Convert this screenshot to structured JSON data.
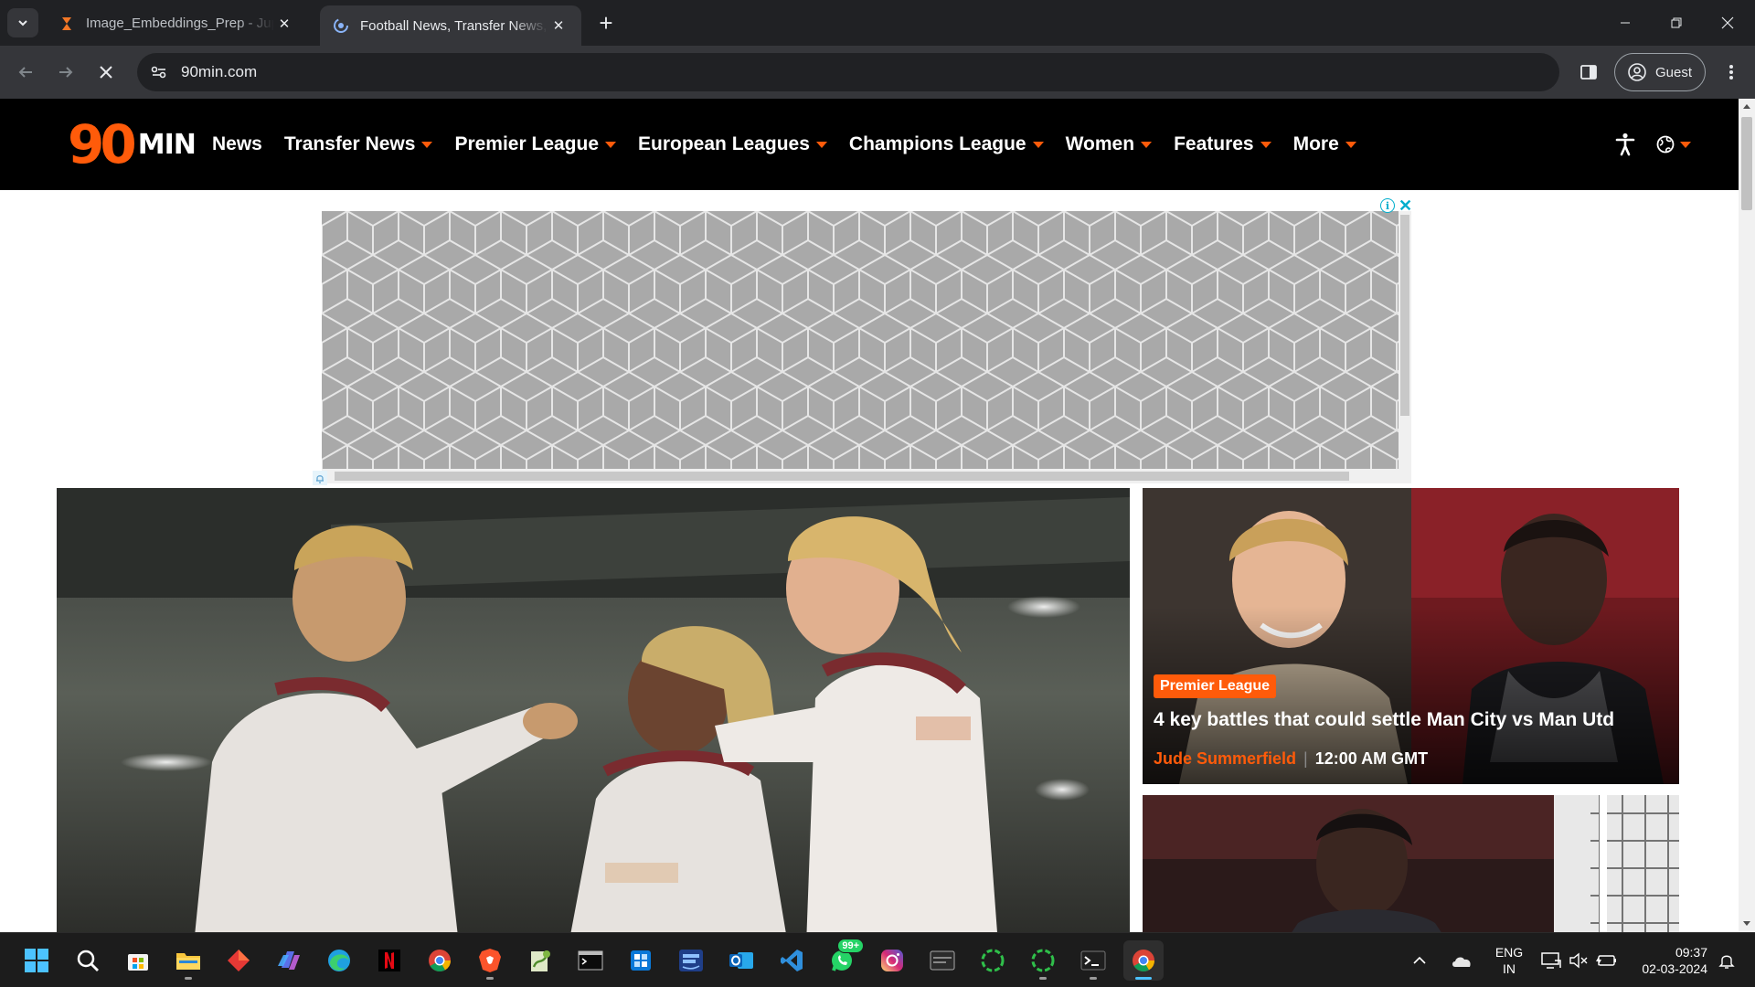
{
  "browser": {
    "tabs": [
      {
        "title": "Image_Embeddings_Prep - Jupyter",
        "active": false,
        "favicon": "hourglass-icon"
      },
      {
        "title": "Football News, Transfer News, Le",
        "active": true,
        "favicon": "loading-spinner-icon"
      }
    ],
    "url": "90min.com",
    "profile_label": "Guest"
  },
  "site": {
    "logo_number": "90",
    "logo_word": "MIN",
    "accent": "#ff5b0a",
    "nav": [
      {
        "label": "News",
        "dropdown": false
      },
      {
        "label": "Transfer News",
        "dropdown": true
      },
      {
        "label": "Premier League",
        "dropdown": true
      },
      {
        "label": "European Leagues",
        "dropdown": true
      },
      {
        "label": "Champions League",
        "dropdown": true
      },
      {
        "label": "Women",
        "dropdown": true
      },
      {
        "label": "Features",
        "dropdown": true
      },
      {
        "label": "More",
        "dropdown": true
      }
    ]
  },
  "ad": {
    "info_label": "i",
    "close_label": "✕"
  },
  "cards": [
    {
      "category": "Premier League",
      "headline": "4 key battles that could settle Man City vs Man Utd",
      "author": "Jude Summerfield",
      "separator": "|",
      "time": "12:00 AM GMT"
    }
  ],
  "taskbar": {
    "apps": [
      "windows-start-icon",
      "search-icon",
      "microsoft-store-icon",
      "file-explorer-icon",
      "app-red-diamond-icon",
      "copilot-icon",
      "edge-icon",
      "netflix-icon",
      "chrome-icon",
      "brave-icon",
      "notepad-plus-icon",
      "terminal-cmd-icon",
      "windows-app-icon",
      "prime-video-icon",
      "outlook-icon",
      "vscode-icon",
      "whatsapp-icon",
      "instagram-icon",
      "terminal-window-icon",
      "loading-ring-icon",
      "loading-ring-icon",
      "windows-terminal-icon",
      "chrome-icon"
    ],
    "whatsapp_badge": "99+",
    "lang_line1": "ENG",
    "lang_line2": "IN",
    "time": "09:37",
    "date": "02-03-2024"
  }
}
